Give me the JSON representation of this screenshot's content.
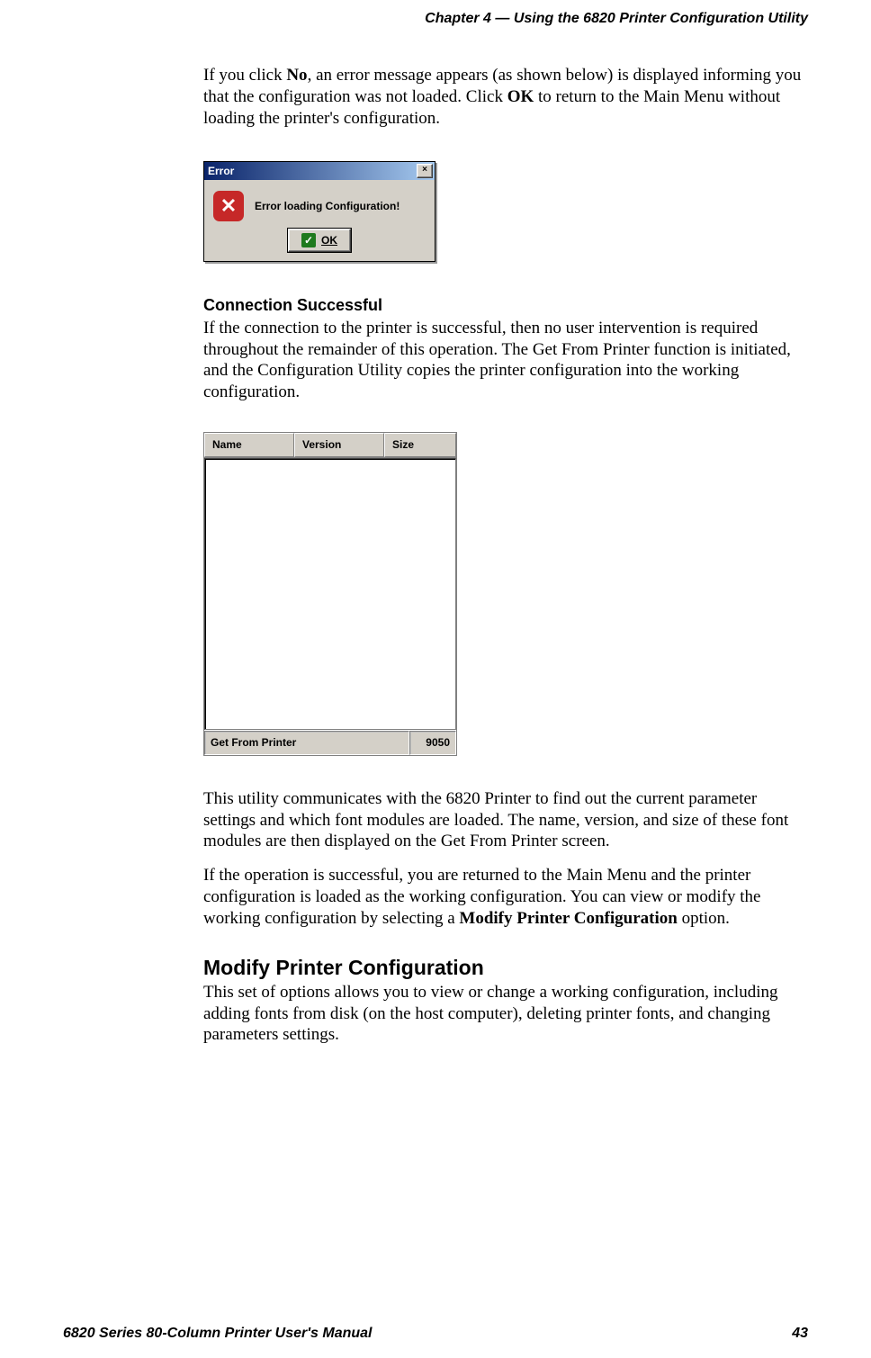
{
  "header": {
    "chapter": "Chapter  4",
    "dash": "  —  ",
    "title": "Using the 6820 Printer Configuration Utility"
  },
  "body": {
    "p1_pre": "If you click ",
    "p1_b1": "No",
    "p1_mid": ", an error message appears (as shown below) is displayed informing you that the configuration was not loaded. Click ",
    "p1_b2": "OK",
    "p1_post": " to return to the Main Menu without loading the printer's configuration.",
    "conn_heading": "Connection Successful",
    "p2": "If the connection to the printer is successful, then no user intervention is required throughout the remainder of this operation. The Get From Printer function is initiated, and the Configuration Utility copies the printer configuration into the working configuration.",
    "p3": "This utility communicates with the 6820 Printer to find out the current parameter settings and which font modules are loaded. The name, version, and size of these font modules are then displayed on the Get From Printer screen.",
    "p4_pre": "If the operation is successful, you are returned to the Main Menu and the printer configuration is loaded as the working configuration. You can view or modify the working configuration by selecting a ",
    "p4_b": "Modify Printer Configuration",
    "p4_post": " option.",
    "mpc_heading": "Modify Printer Configuration",
    "p5": "This set of options allows you to view or change a working configuration, including adding fonts from disk (on the host computer), deleting printer fonts, and changing parameters settings."
  },
  "error_dialog": {
    "title": "Error",
    "close": "×",
    "icon_glyph": "✕",
    "message": "Error loading Configuration!",
    "ok_label": "OK",
    "check_glyph": "✓"
  },
  "list_panel": {
    "cols": {
      "name": "Name",
      "version": "Version",
      "size": "Size"
    },
    "status_left": "Get From Printer",
    "status_right": "9050"
  },
  "footer": {
    "left": "6820 Series 80-Column Printer User's Manual",
    "right": "43"
  }
}
